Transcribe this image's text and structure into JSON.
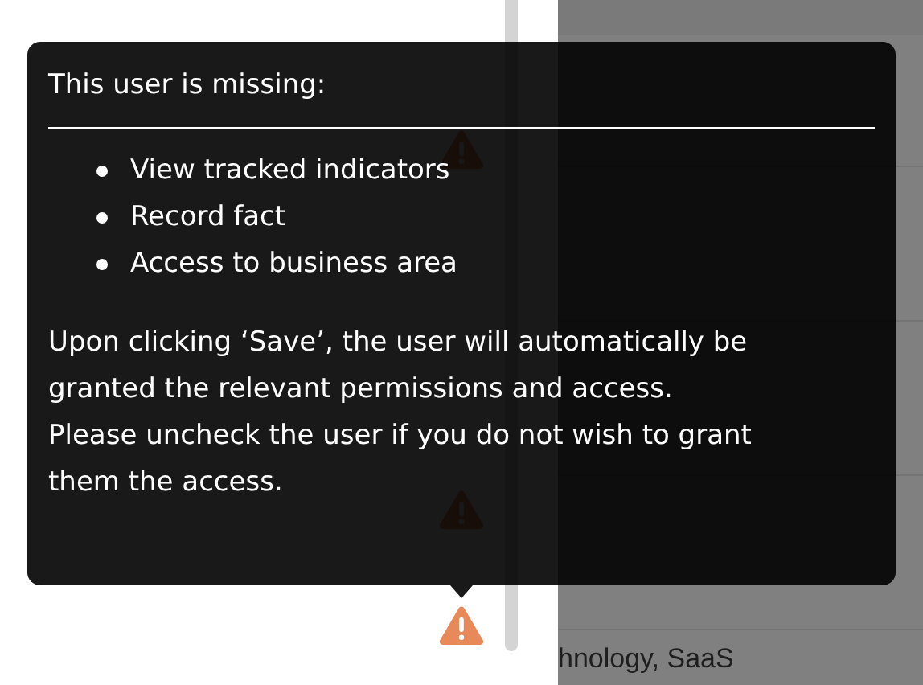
{
  "table": {
    "last_row": "hnology, SaaS"
  },
  "tooltip": {
    "title": "This user is missing:",
    "items": [
      "View tracked indicators",
      "Record fact",
      "Access to business area"
    ],
    "message_lines": [
      "Upon clicking ‘Save’, the user will automatically be",
      "granted the relevant permissions and access.",
      "Please uncheck the user if you do not wish to grant",
      "them the access."
    ]
  }
}
